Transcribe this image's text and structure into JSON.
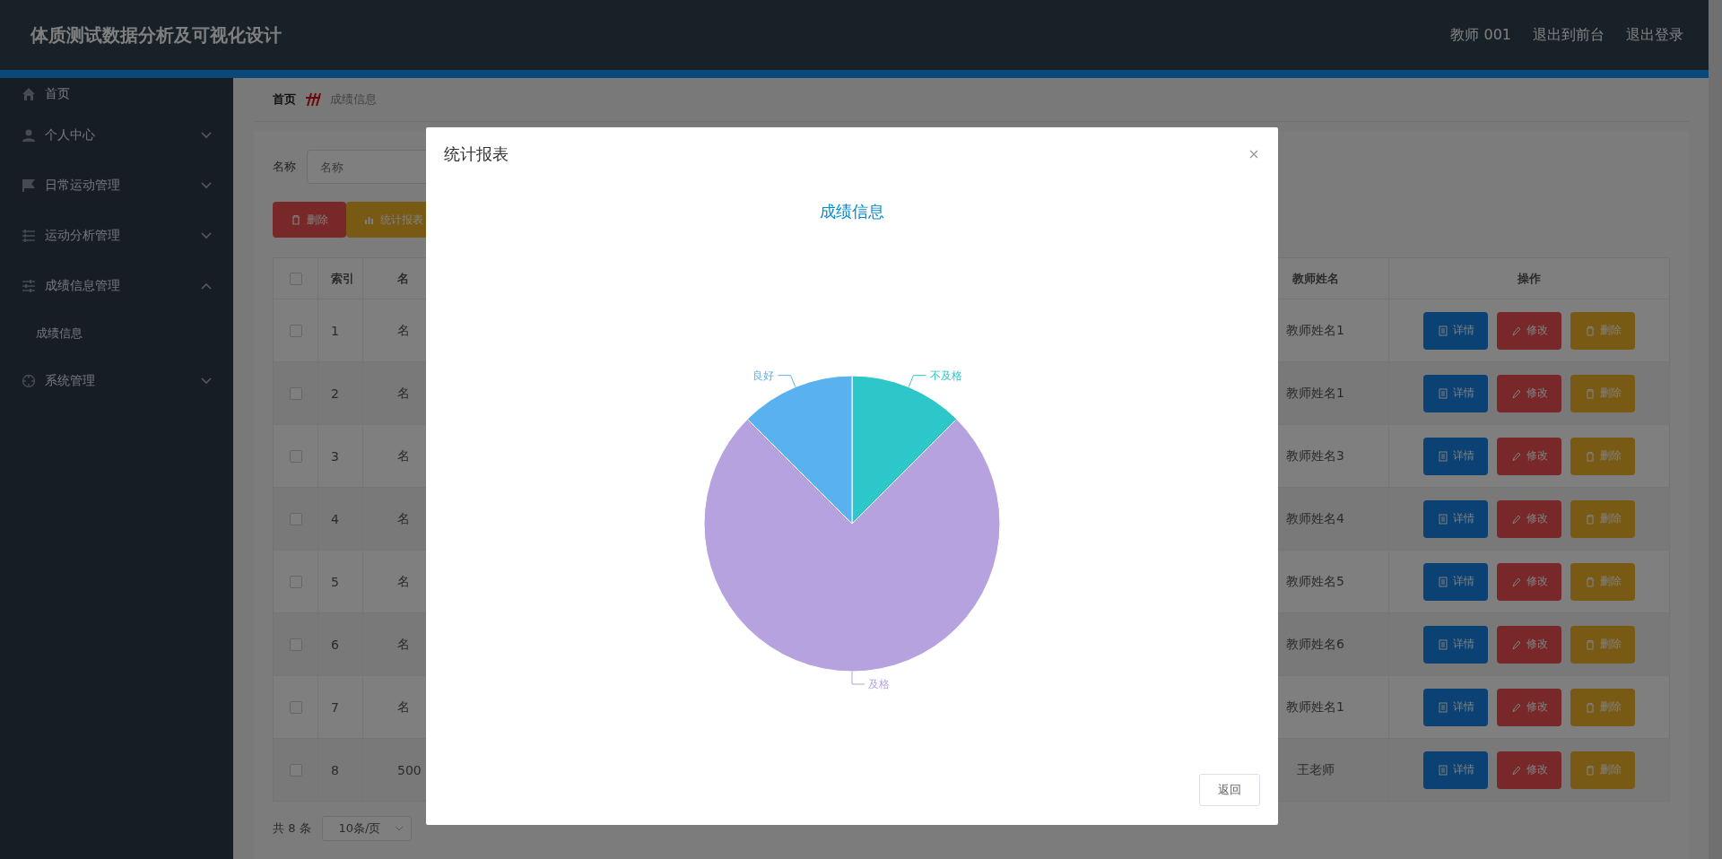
{
  "header": {
    "title": "体质测试数据分析及可视化设计",
    "links": [
      "教师 001",
      "退出到前台",
      "退出登录"
    ]
  },
  "sidebar": {
    "items": [
      {
        "label": "首页",
        "kind": "link"
      },
      {
        "label": "个人中心",
        "kind": "menu",
        "expanded": false
      },
      {
        "label": "日常运动管理",
        "kind": "menu",
        "expanded": false
      },
      {
        "label": "运动分析管理",
        "kind": "menu",
        "expanded": false
      },
      {
        "label": "成绩信息管理",
        "kind": "menu",
        "expanded": true,
        "children": [
          {
            "label": "成绩信息"
          }
        ]
      },
      {
        "label": "系统管理",
        "kind": "menu",
        "expanded": false
      }
    ]
  },
  "breadcrumb": [
    "首页",
    "成绩信息"
  ],
  "search": {
    "label": "名称",
    "placeholder": "名称"
  },
  "toolbar": [
    {
      "label": "删除",
      "kind": "danger"
    },
    {
      "label": "统计报表",
      "kind": "warning"
    }
  ],
  "table": {
    "header_checked": false,
    "columns": [
      "索引",
      "名",
      "教师姓名",
      "操作"
    ],
    "rows": [
      {
        "checked": false,
        "index": "1",
        "column_3": "名",
        "teacher": "教师姓名1",
        "actions": [
          "详情",
          "修改",
          "删除"
        ]
      },
      {
        "checked": false,
        "index": "2",
        "column_3": "名",
        "teacher": "教师姓名1",
        "actions": [
          "详情",
          "修改",
          "删除"
        ]
      },
      {
        "checked": false,
        "index": "3",
        "column_3": "名",
        "teacher": "教师姓名3",
        "actions": [
          "详情",
          "修改",
          "删除"
        ]
      },
      {
        "checked": false,
        "index": "4",
        "column_3": "名",
        "teacher": "教师姓名4",
        "actions": [
          "详情",
          "修改",
          "删除"
        ]
      },
      {
        "checked": false,
        "index": "5",
        "column_3": "名",
        "teacher": "教师姓名5",
        "actions": [
          "详情",
          "修改",
          "删除"
        ]
      },
      {
        "checked": false,
        "index": "6",
        "column_3": "名",
        "teacher": "教师姓名6",
        "actions": [
          "详情",
          "修改",
          "删除"
        ]
      },
      {
        "checked": false,
        "index": "7",
        "column_3": "名",
        "teacher": "教师姓名1",
        "actions": [
          "详情",
          "修改",
          "删除"
        ]
      },
      {
        "checked": false,
        "index": "8",
        "column_3": "500",
        "teacher": "王老师",
        "actions": [
          "详情",
          "修改",
          "删除"
        ]
      }
    ]
  },
  "pagination": {
    "total": "共 8 条",
    "page_size": "10条/页"
  },
  "dialog": {
    "title": "统计报表",
    "button": "返回",
    "chart_data": {
      "type": "pie",
      "title": "成绩信息",
      "categories": [
        "不及格",
        "及格",
        "良好"
      ],
      "values": [
        12.5,
        75,
        12.5
      ]
    }
  }
}
